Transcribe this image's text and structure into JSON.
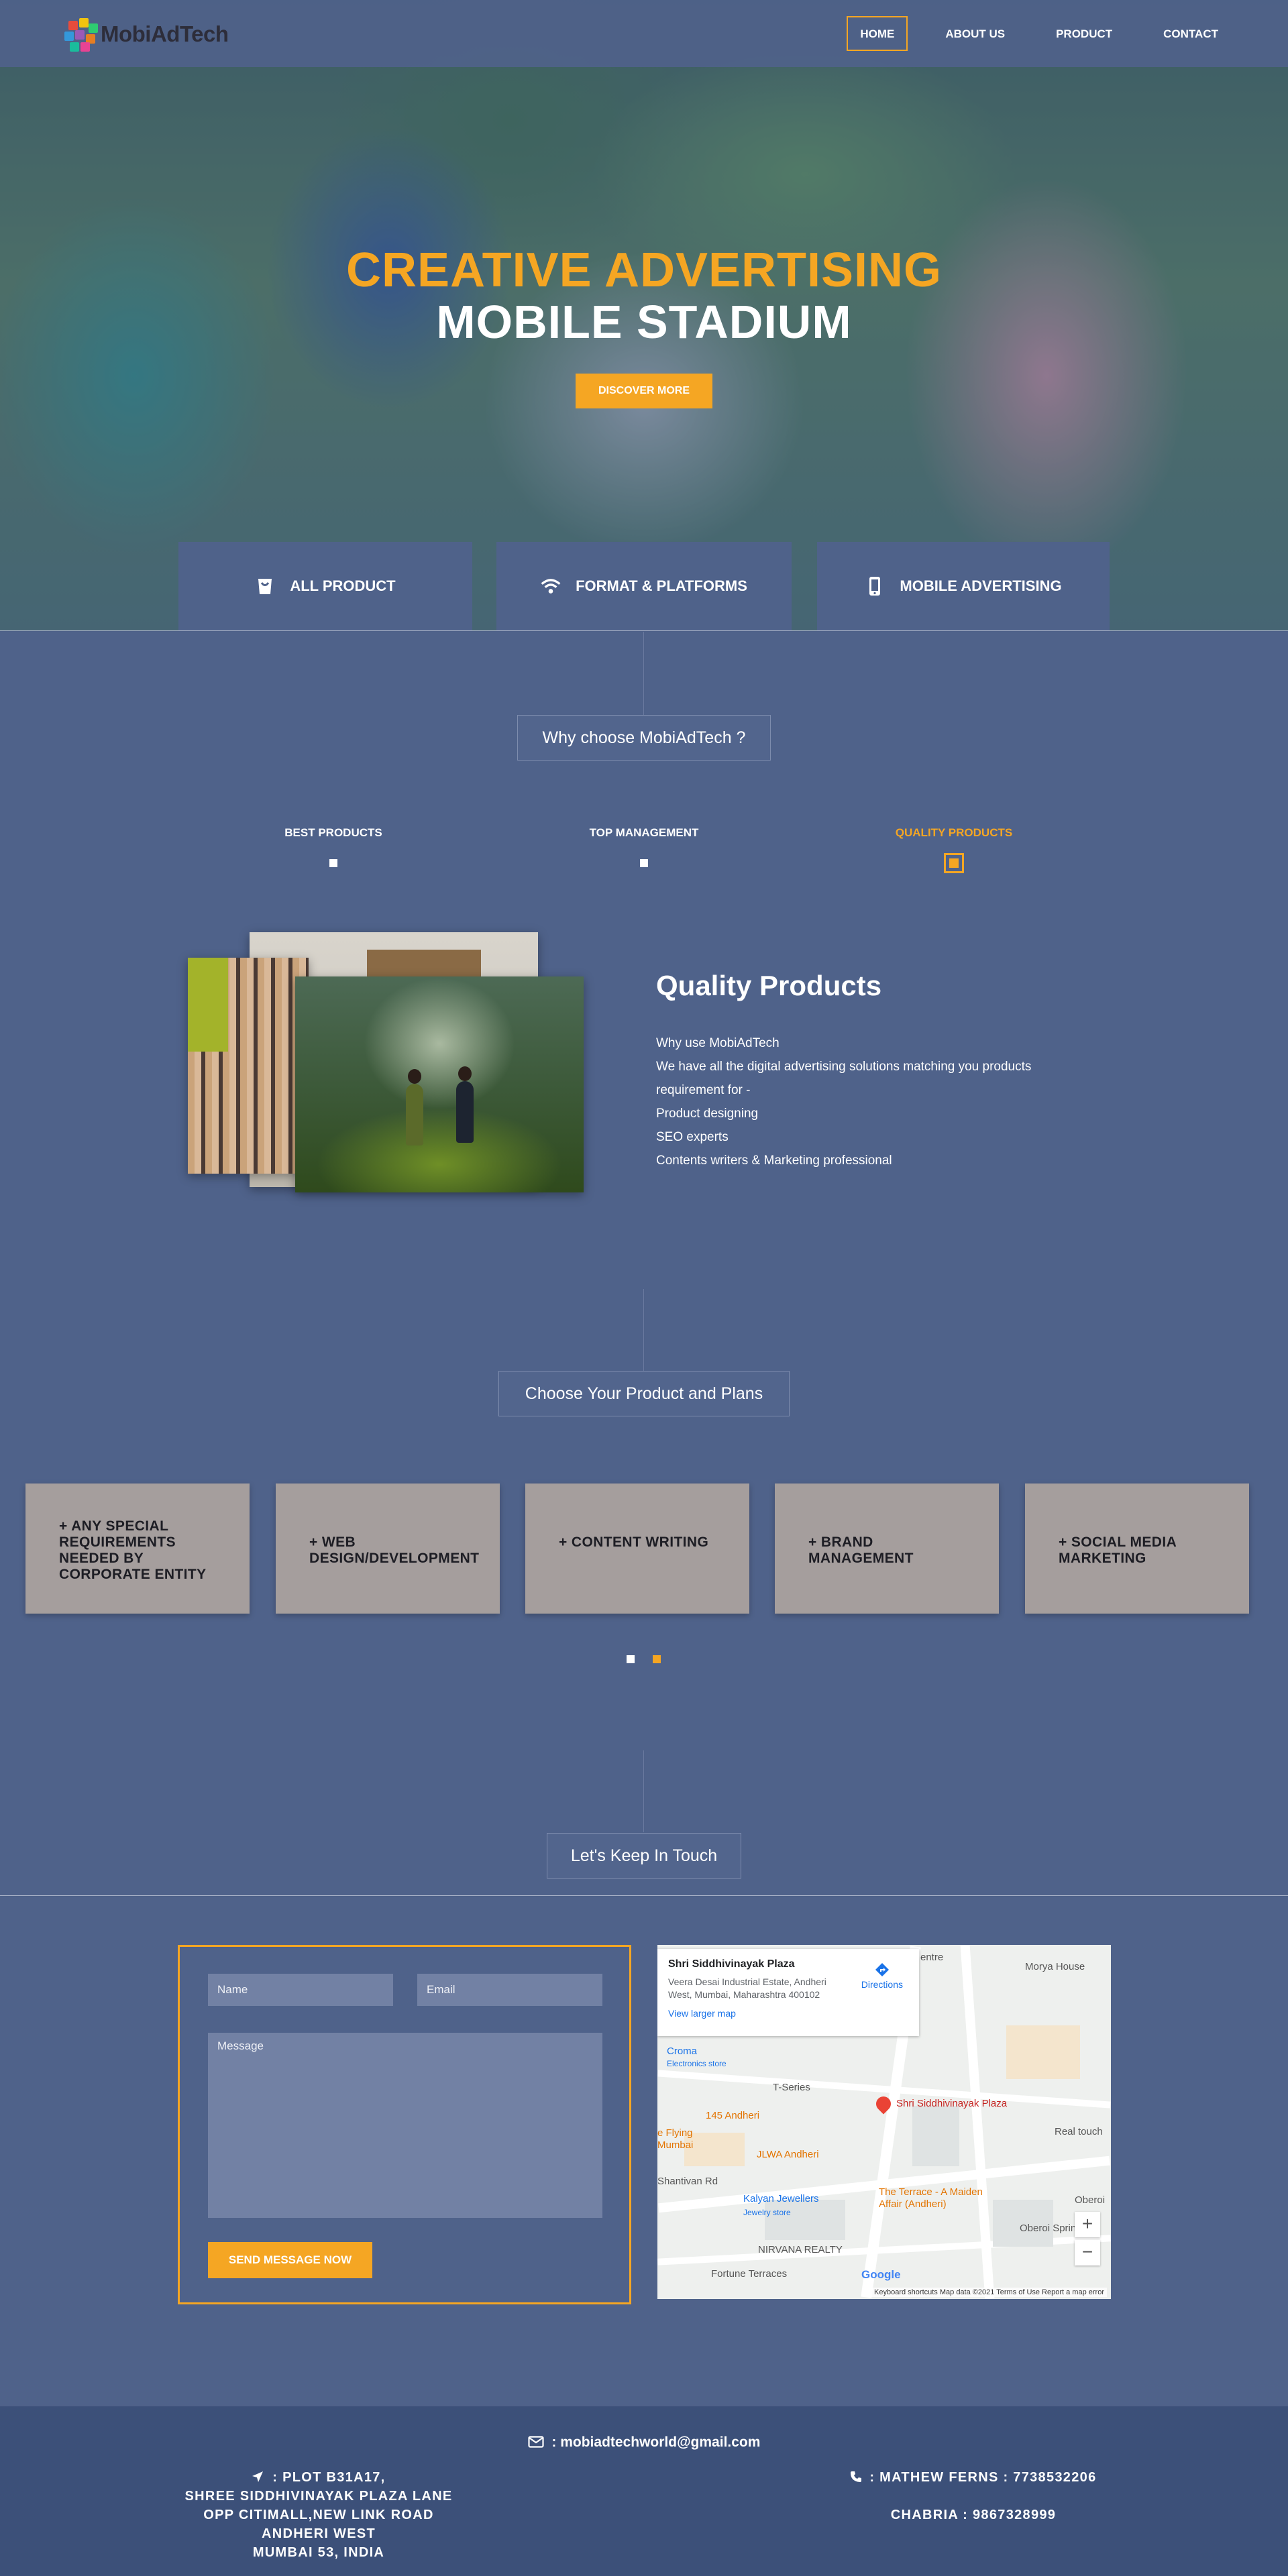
{
  "colors": {
    "accent": "#f5a623",
    "page_bg": "#4f628a",
    "footer_bg": "#3c5079",
    "card_bg": "#a59e9d"
  },
  "nav": {
    "logo_text": "MobiAdTech",
    "links": [
      "HOME",
      "ABOUT US",
      "PRODUCT",
      "CONTACT"
    ],
    "active": "HOME"
  },
  "hero": {
    "line1": "CREATIVE ADVERTISING",
    "line2": "MOBILE STADIUM",
    "button": "DISCOVER MORE",
    "tabs": [
      {
        "label": "ALL PRODUCT",
        "icon": "shopping-bag-icon"
      },
      {
        "label": "FORMAT & PLATFORMS",
        "icon": "wifi-icon"
      },
      {
        "label": "MOBILE ADVERTISING",
        "icon": "mobile-phone-icon"
      }
    ]
  },
  "why": {
    "heading": "Why choose MobiAdTech ?",
    "tabs": [
      "BEST PRODUCTS",
      "TOP MANAGEMENT",
      "QUALITY PRODUCTS"
    ],
    "active_tab": "QUALITY PRODUCTS",
    "content_title": "Quality Products",
    "content_lines": [
      "Why use MobiAdTech",
      "We have all the digital advertising solutions matching you products",
      "requirement for -",
      "Product designing",
      "SEO experts",
      "Contents writers & Marketing professional"
    ]
  },
  "plans": {
    "heading": "Choose Your Product and Plans",
    "cards": [
      [
        "+ ANY SPECIAL",
        "REQUIREMENTS",
        "NEEDED BY",
        "CORPORATE ENTITY"
      ],
      [
        "+ WEB",
        "DESIGN/DEVELOPMENT"
      ],
      [
        "+ CONTENT WRITING"
      ],
      [
        "+ BRAND",
        "MANAGEMENT"
      ],
      [
        "+ SOCIAL MEDIA",
        "MARKETING"
      ]
    ],
    "pagination_active": 1
  },
  "contact": {
    "heading": "Let's Keep In Touch",
    "name_placeholder": "Name",
    "email_placeholder": "Email",
    "message_placeholder": "Message",
    "send_label": "SEND MESSAGE NOW"
  },
  "map": {
    "place_name": "Shri Siddhivinayak Plaza",
    "address": "Veera Desai Industrial Estate, Andheri West, Mumbai, Maharashtra 400102",
    "directions": "Directions",
    "larger_map": "View larger map",
    "pin_label": "Shri Siddhivinayak Plaza",
    "labels": {
      "centre": "entre",
      "morya": "Morya House",
      "croma": "Croma",
      "croma_sub": "Electronics store",
      "tseries": "T-Series",
      "flying": "e Flying",
      "flying2": "Mumbai",
      "andheri145": "145 Andheri",
      "jlwa": "JLWA Andheri",
      "realtouch": "Real touch",
      "shantivan": "Shantivan Rd",
      "kalyan": "Kalyan Jewellers",
      "kalyan_sub": "Jewelry store",
      "terrace": "The Terrace - A Maiden",
      "terrace2": "Affair (Andheri)",
      "oberoi": "Oberoi",
      "oberoi_spr": "Oberoi Sprin",
      "nirvana": "NIRVANA REALTY",
      "fortune": "Fortune Terraces",
      "google": "Google"
    },
    "zoom_in": "+",
    "zoom_out": "−",
    "footer_items": "Keyboard shortcuts   Map data ©2021   Terms of Use   Report a map error"
  },
  "footer": {
    "email": ": mobiadtechworld@gmail.com",
    "address_lines": [
      ": PLOT B31A17,",
      "SHREE SIDDHIVINAYAK PLAZA LANE",
      "OPP CITIMALL,NEW LINK ROAD",
      "ANDHERI WEST",
      "MUMBAI 53, INDIA"
    ],
    "phone1": ": MATHEW FERNS : 7738532206",
    "phone2": "CHABRIA : 9867328999"
  }
}
